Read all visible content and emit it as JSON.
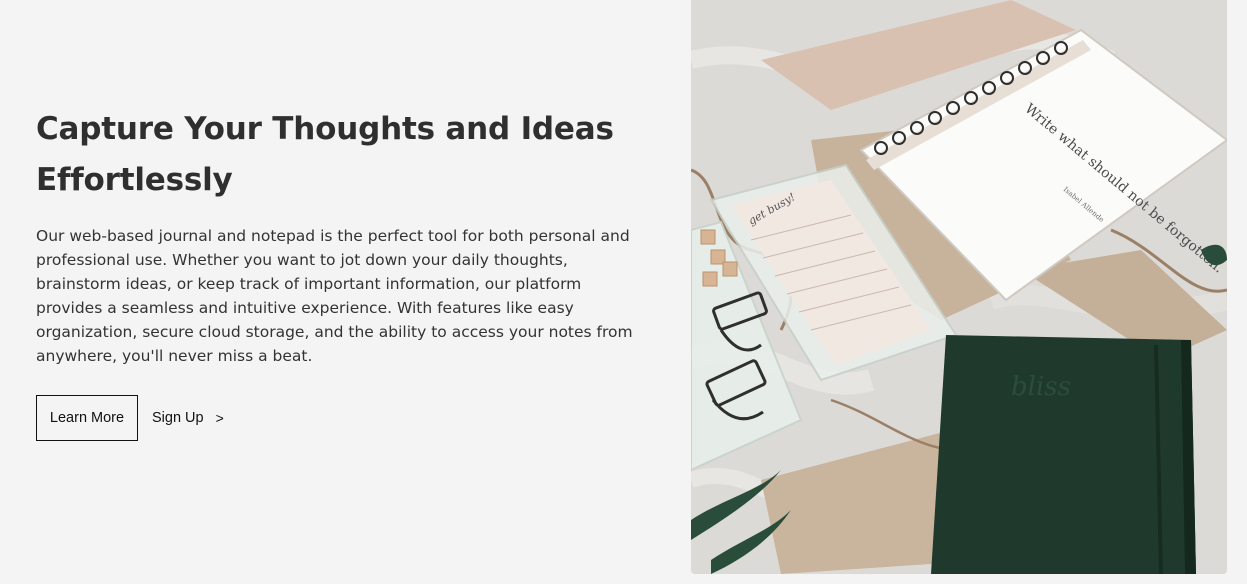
{
  "hero": {
    "title": "Capture Your Thoughts and Ideas Effortlessly",
    "description": "Our web-based journal and notepad is the perfect tool for both personal and professional use. Whether you want to jot down your daily thoughts, brainstorm ideas, or keep track of important information, our platform provides a seamless and intuitive experience. With features like easy organization, secure cloud storage, and the ability to access your notes from anywhere, you'll never miss a beat."
  },
  "actions": {
    "primary_label": "Learn More",
    "secondary_label": "Sign Up",
    "secondary_icon": "chevron-right-icon"
  },
  "image": {
    "name": "journal-and-notebooks-photo",
    "notebook_quote": "Write what should not be forgotten.",
    "notebook_quote_author": "Isabel Allende",
    "notepad_header": "get busy!",
    "cover_lettering": "bliss"
  },
  "colors": {
    "background": "#f4f4f4",
    "text": "#2f2f2f",
    "button_border": "#111111",
    "notebook_green": "#1f3a2c"
  }
}
